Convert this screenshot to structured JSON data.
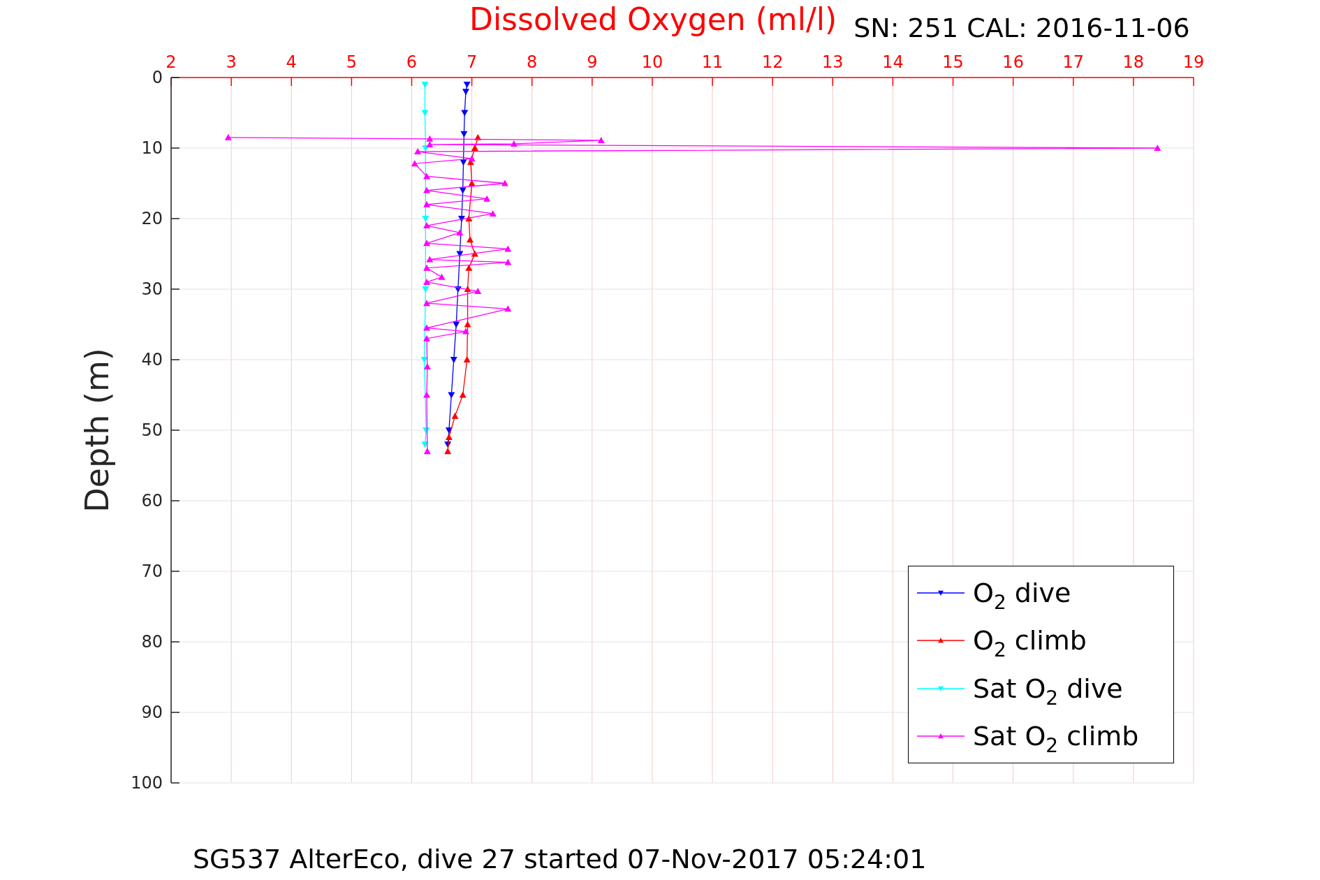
{
  "figure": {
    "subtitle": "SN: 251  CAL: 2016-11-06",
    "caption": "SG537 AlterEco, dive 27 started 07-Nov-2017 05:24:01",
    "chart_data": {
      "type": "line",
      "title": "Dissolved Oxygen (ml/l)",
      "ylabel": "Depth (m)",
      "xlim": [
        2,
        19
      ],
      "ylim": [
        100,
        0
      ],
      "xticks": [
        2,
        3,
        4,
        5,
        6,
        7,
        8,
        9,
        10,
        11,
        12,
        13,
        14,
        15,
        16,
        17,
        18,
        19
      ],
      "yticks": [
        0,
        10,
        20,
        30,
        40,
        50,
        60,
        70,
        80,
        90,
        100
      ],
      "grid": true,
      "legend": true,
      "series": [
        {
          "name": "O$_{2}$ dive",
          "color": "#0000ff",
          "marker": "triangle",
          "x": [
            6.92,
            6.9,
            6.88,
            6.87,
            6.86,
            6.85,
            6.83,
            6.8,
            6.77,
            6.74,
            6.7,
            6.66,
            6.62,
            6.6
          ],
          "values": [
            1,
            2,
            5,
            8,
            12,
            16,
            20,
            25,
            30,
            35,
            40,
            45,
            50,
            52
          ]
        },
        {
          "name": "O$_{2}$ climb",
          "color": "#ff0000",
          "marker": "triangle",
          "x": [
            6.6,
            6.62,
            6.72,
            6.85,
            6.92,
            6.93,
            6.93,
            6.95,
            7.05,
            6.97,
            6.95,
            7.0,
            6.98,
            7.05,
            7.1
          ],
          "values": [
            53,
            51,
            48,
            45,
            40,
            35,
            30,
            27,
            25,
            23,
            20,
            15,
            12,
            10,
            8.5
          ]
        },
        {
          "name": "Sat O$_{2}$ dive",
          "color": "#00ffff",
          "marker": "triangle",
          "x": [
            6.22,
            6.22,
            6.23,
            6.23,
            6.23,
            6.21,
            6.24,
            6.22
          ],
          "values": [
            1,
            5,
            10,
            20,
            30,
            40,
            50,
            52
          ]
        },
        {
          "name": "Sat O$_{2}$ climb",
          "color": "#ff00ff",
          "marker": "triangle",
          "x": [
            6.26,
            6.25,
            6.26,
            6.25,
            6.9,
            6.25,
            7.6,
            6.25,
            7.1,
            6.25,
            6.5,
            6.25,
            7.6,
            6.3,
            7.6,
            6.25,
            6.8,
            6.25,
            7.35,
            6.25,
            7.25,
            6.25,
            7.55,
            6.25,
            6.05,
            7.0,
            6.1,
            18.4,
            6.3,
            7.7,
            9.15,
            6.3,
            2.95
          ],
          "values": [
            53,
            45,
            41,
            37,
            36,
            35.5,
            32.8,
            32,
            30.3,
            29,
            28.3,
            27,
            26.2,
            25.8,
            24.3,
            23.5,
            22,
            21,
            19.3,
            18,
            17.2,
            16,
            15,
            14,
            12.2,
            11.5,
            10.5,
            10,
            9.5,
            9.4,
            8.9,
            8.7,
            8.5
          ]
        }
      ]
    }
  }
}
